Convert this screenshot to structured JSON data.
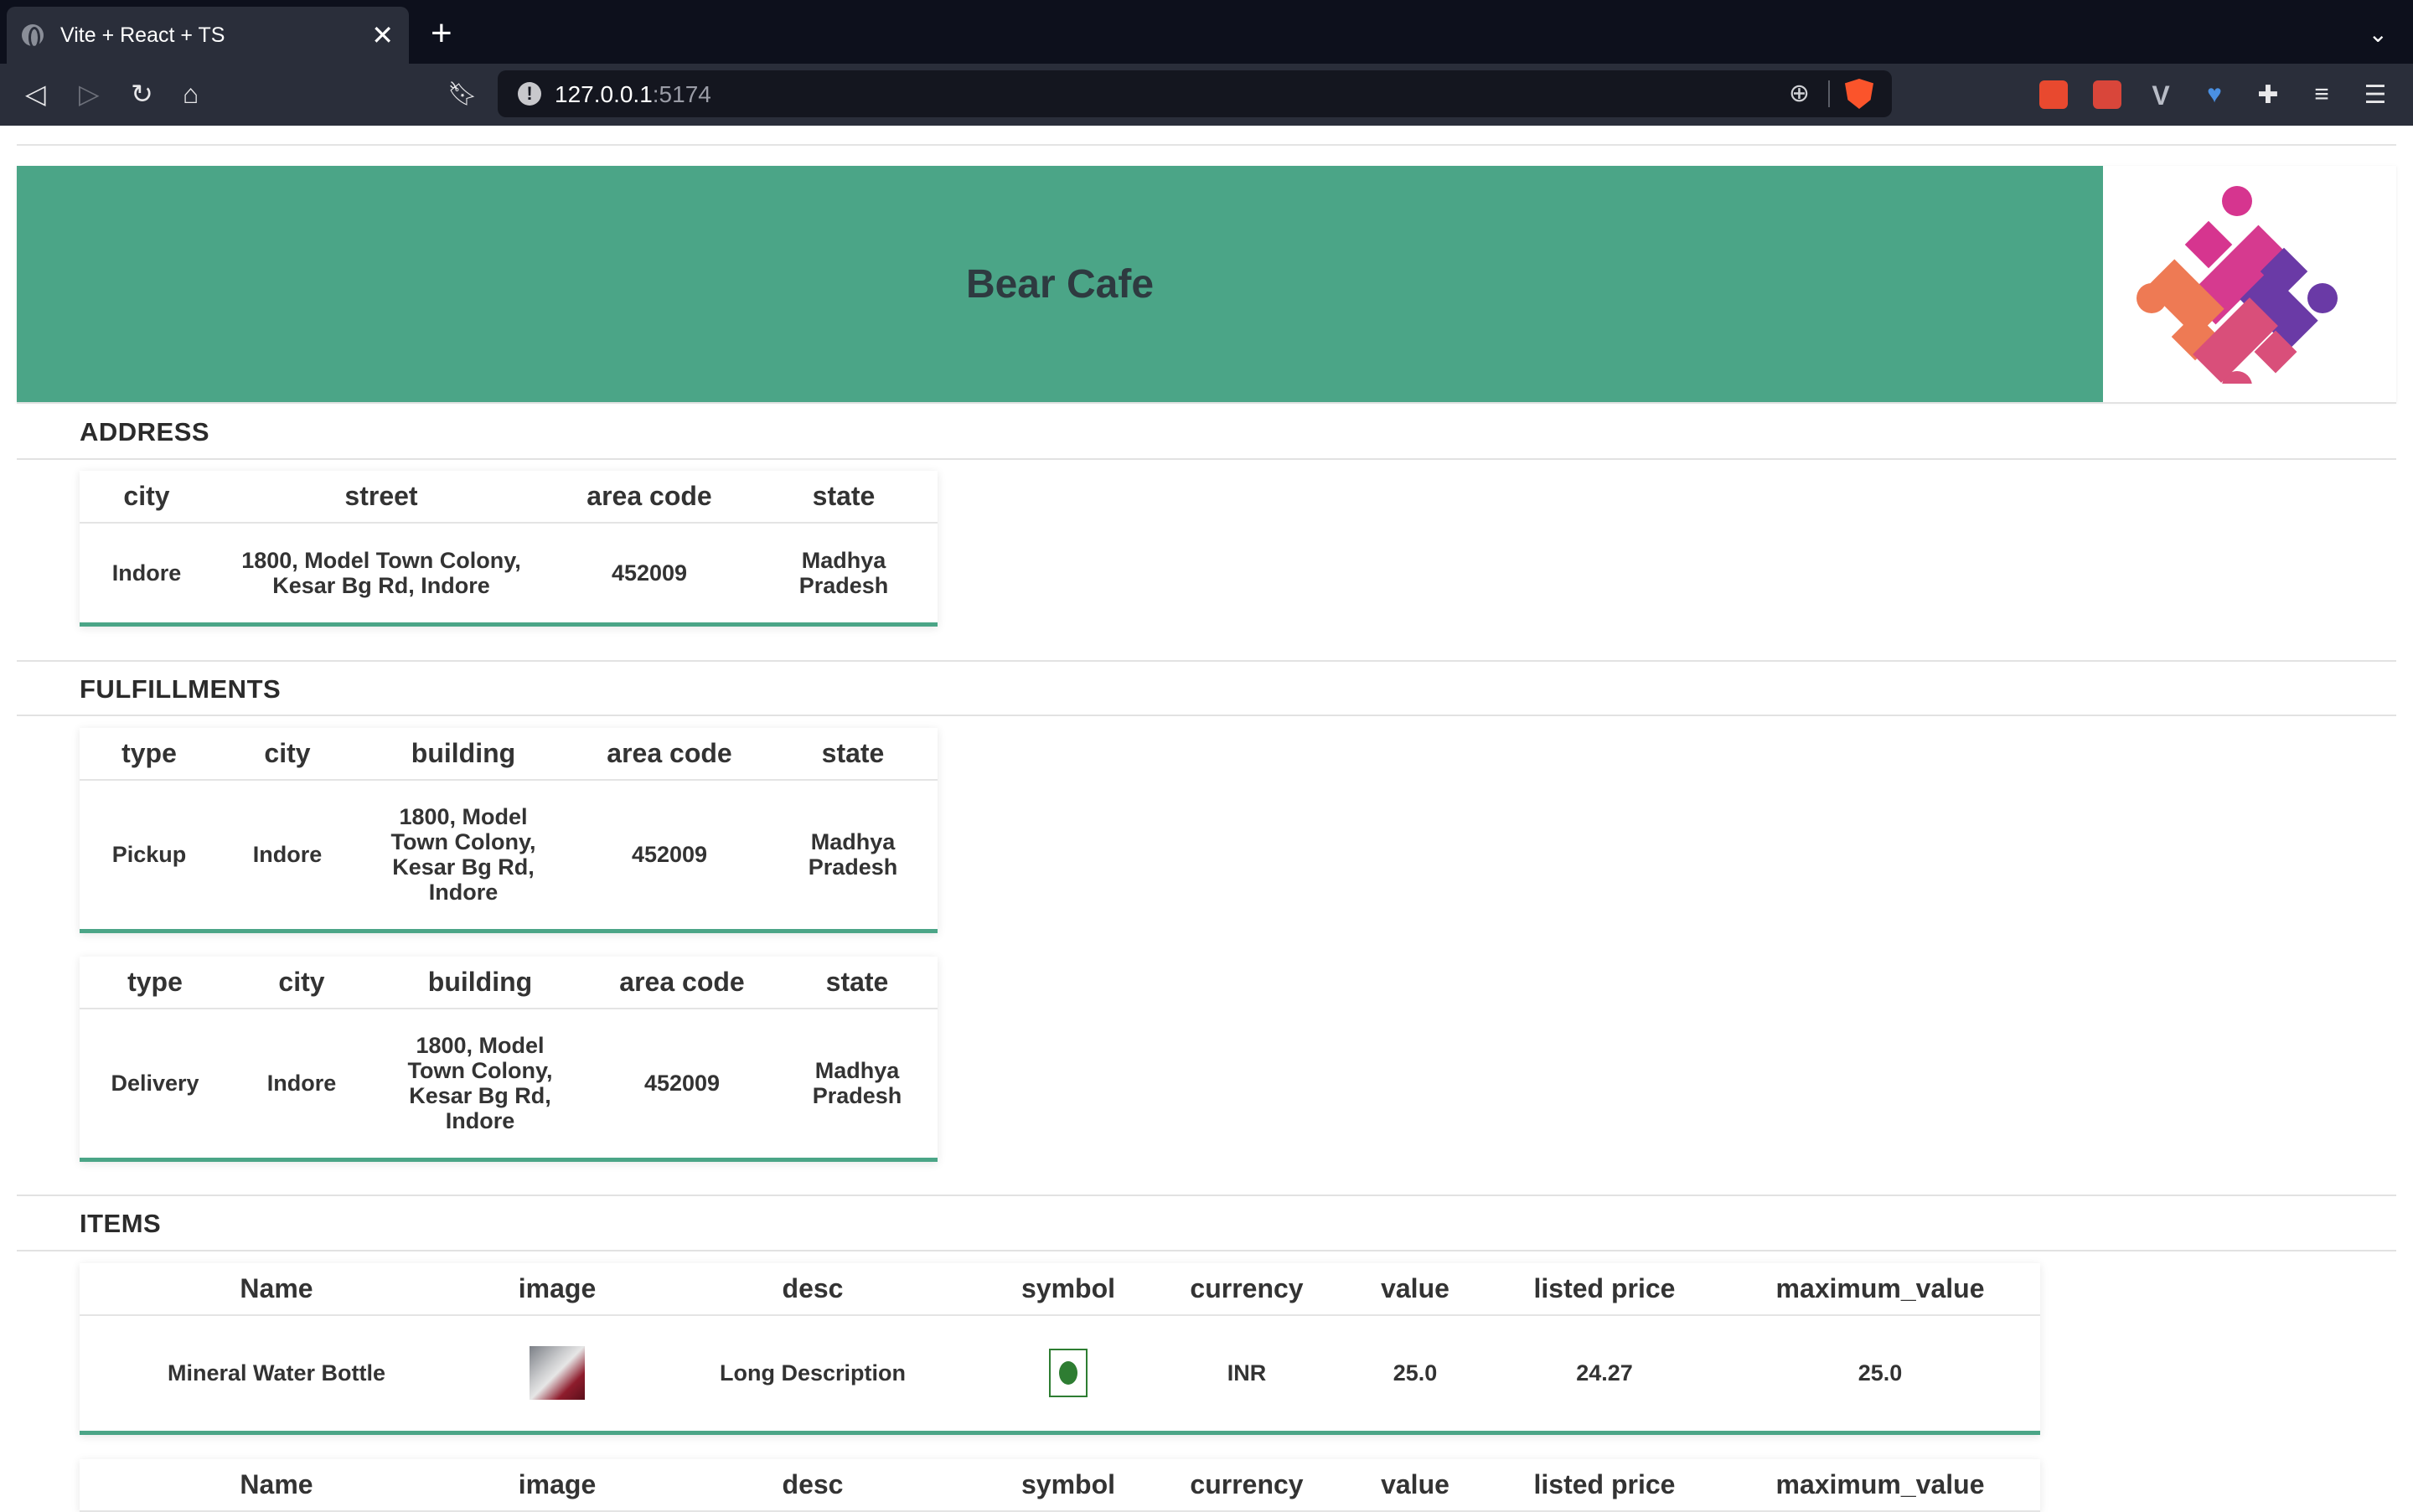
{
  "browser": {
    "tab_title": "Vite + React + TS",
    "tab_close": "✕",
    "new_tab": "+",
    "url_host": "127.0.0.1",
    "url_port": ":5174",
    "icons": [
      "back-icon",
      "forward-icon",
      "reload-icon",
      "home-icon",
      "bookmark-icon",
      "zoom-icon",
      "brave-shield-icon",
      "extensions-icon",
      "reading-list-icon",
      "menu-icon"
    ]
  },
  "store": {
    "name": "Bear Cafe",
    "banner_color": "#4ba587"
  },
  "address": {
    "title": "ADDRESS",
    "headers": [
      "city",
      "street",
      "area code",
      "state"
    ],
    "row": {
      "city": "Indore",
      "street_line1": "1800, Model Town Colony,",
      "street_line2": "Kesar Bg Rd, Indore",
      "area_code": "452009",
      "state_line1": "Madhya",
      "state_line2": "Pradesh"
    }
  },
  "fulfillments": {
    "title": "FULFILLMENTS",
    "headers": [
      "type",
      "city",
      "building",
      "area code",
      "state"
    ],
    "rows": [
      {
        "type": "Pickup",
        "city": "Indore",
        "building_lines": [
          "1800, Model",
          "Town Colony,",
          "Kesar Bg Rd,",
          "Indore"
        ],
        "area_code": "452009",
        "state_line1": "Madhya",
        "state_line2": "Pradesh"
      },
      {
        "type": "Delivery",
        "city": "Indore",
        "building_lines": [
          "1800, Model",
          "Town Colony,",
          "Kesar Bg Rd,",
          "Indore"
        ],
        "area_code": "452009",
        "state_line1": "Madhya",
        "state_line2": "Pradesh"
      }
    ]
  },
  "items": {
    "title": "ITEMS",
    "headers": [
      "Name",
      "image",
      "desc",
      "symbol",
      "currency",
      "value",
      "listed price",
      "maximum_value"
    ],
    "rows": [
      {
        "name": "Mineral Water Bottle",
        "desc": "Long Description",
        "currency": "INR",
        "value": "25.0",
        "listed_price": "24.27",
        "maximum_value": "25.0"
      }
    ]
  }
}
